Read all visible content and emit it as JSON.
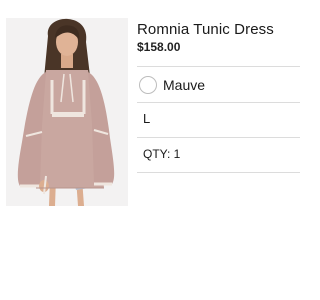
{
  "product": {
    "image_icon": "model-wearing-tunic-photo",
    "title": "Romnia Tunic Dress",
    "price": "$158.00",
    "color": {
      "label": "Mauve",
      "swatch_color": "#ffffff"
    },
    "size": "L",
    "quantity": "QTY: 1"
  },
  "colors": {
    "divider": "#dcdcdc",
    "dress": "#c9a7a0",
    "photo_background": "#f1f1f1"
  }
}
